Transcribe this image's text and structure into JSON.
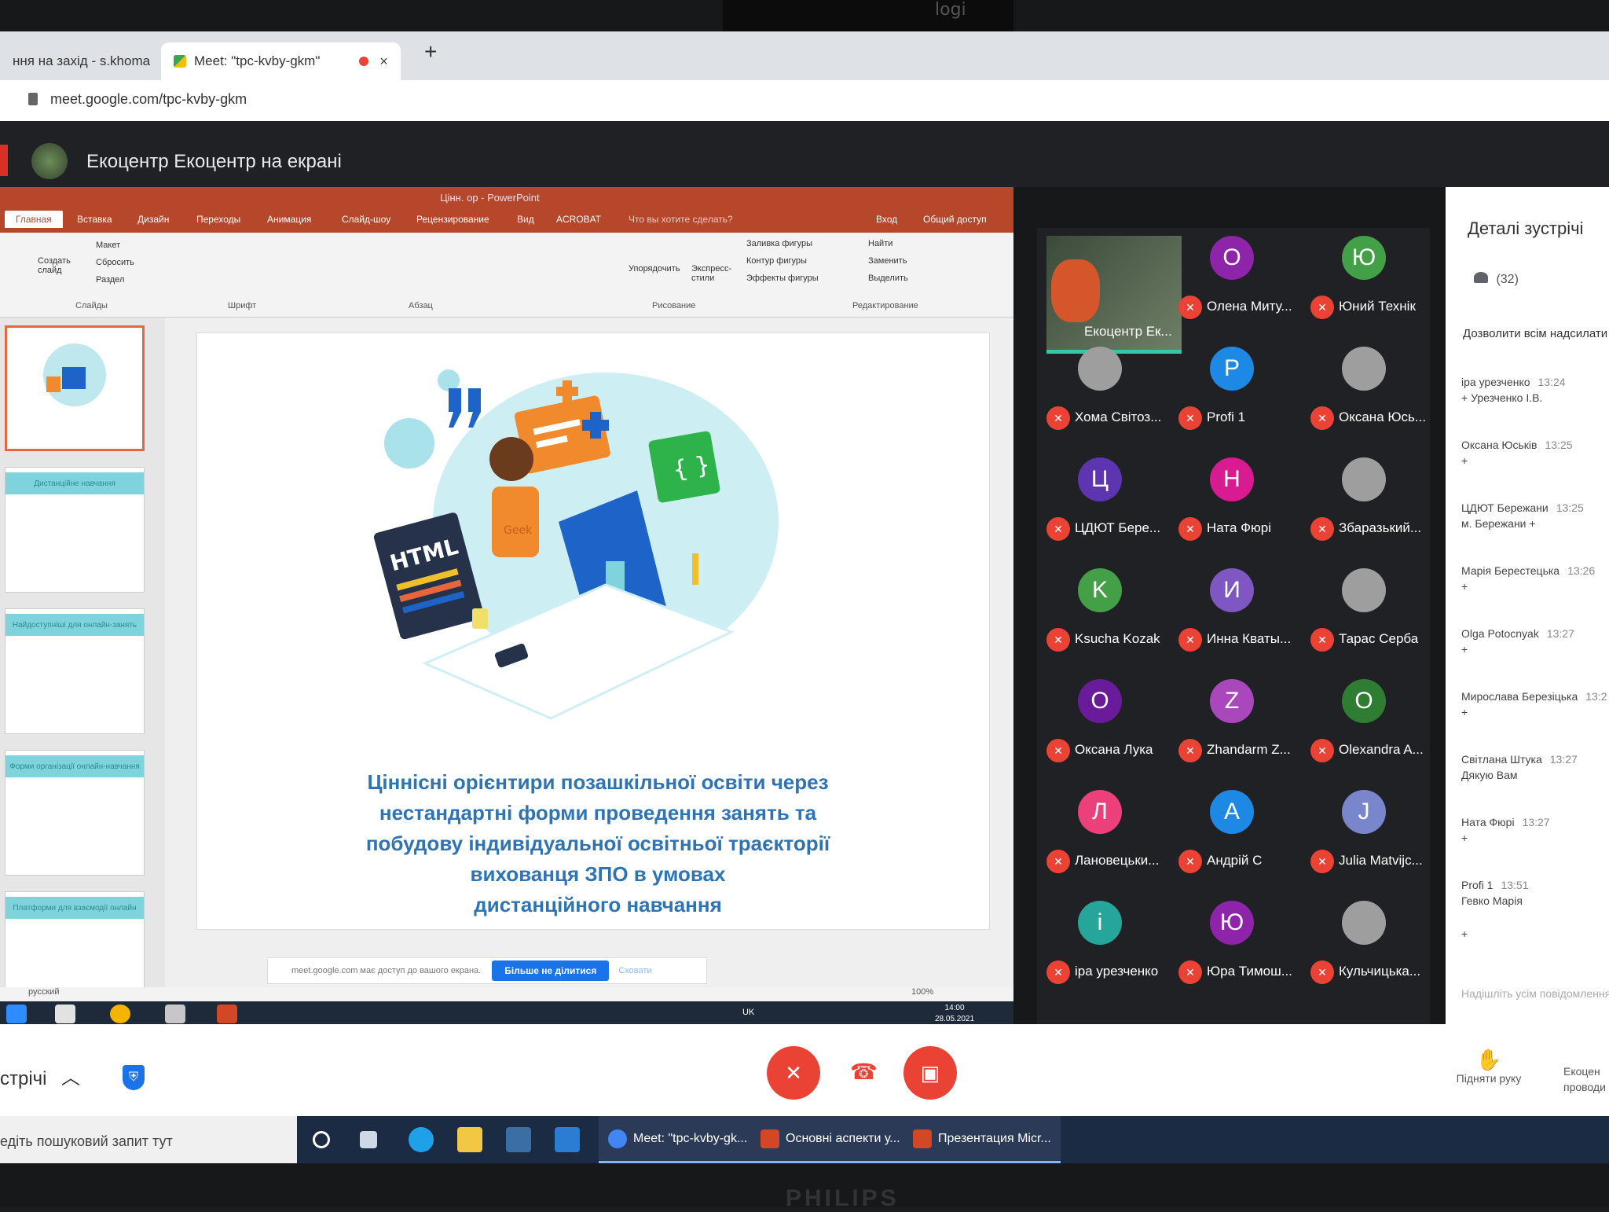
{
  "browser": {
    "tabs": [
      {
        "label": "ння на захід - s.khoma",
        "close": "×"
      },
      {
        "label": "Meet: \"tpc-kvby-gkm\"",
        "close": "×"
      }
    ],
    "new_tab": "+",
    "url": "meet.google.com/tpc-kvby-gkm"
  },
  "meet": {
    "presenter_title": "Екоцентр Екоцентр на екрані",
    "participants": [
      {
        "name": "Екоцентр Ек...",
        "initial": "",
        "color": "",
        "video": true
      },
      {
        "name": "Олена Миту...",
        "initial": "О",
        "color": "#8e24aa"
      },
      {
        "name": "Юний Технік",
        "initial": "Ю",
        "color": "#43a047"
      },
      {
        "name": "Хома Світоз...",
        "initial": "",
        "color": "#9e9e9e"
      },
      {
        "name": "Profi 1",
        "initial": "P",
        "color": "#1e88e5"
      },
      {
        "name": "Оксана Юсь...",
        "initial": "",
        "color": "#9e9e9e"
      },
      {
        "name": "ЦДЮТ Бере...",
        "initial": "Ц",
        "color": "#5e35b1"
      },
      {
        "name": "Ната Фюрі",
        "initial": "Н",
        "color": "#d81b90"
      },
      {
        "name": "Збаразький...",
        "initial": "",
        "color": "#9e9e9e"
      },
      {
        "name": "Ksucha Kozak",
        "initial": "K",
        "color": "#43a047"
      },
      {
        "name": "Инна Кваты...",
        "initial": "И",
        "color": "#7e57c2"
      },
      {
        "name": "Тарас Серба",
        "initial": "",
        "color": "#9e9e9e"
      },
      {
        "name": "Оксана Лука",
        "initial": "О",
        "color": "#6a1b9a"
      },
      {
        "name": "Zhandarm Z...",
        "initial": "Z",
        "color": "#ab47bc"
      },
      {
        "name": "Olexandra A...",
        "initial": "O",
        "color": "#2e7d32"
      },
      {
        "name": "Лановецьки...",
        "initial": "Л",
        "color": "#ec407a"
      },
      {
        "name": "Андрій С",
        "initial": "А",
        "color": "#1e88e5"
      },
      {
        "name": "Julia Matvijc...",
        "initial": "J",
        "color": "#7986cb"
      },
      {
        "name": "іра урезченко",
        "initial": "і",
        "color": "#26a69a"
      },
      {
        "name": "Юра Тимош...",
        "initial": "Ю",
        "color": "#8e24aa"
      },
      {
        "name": "Кульчицька...",
        "initial": "",
        "color": "#9e9e9e"
      }
    ],
    "panel": {
      "title": "Деталі зустрічі",
      "count": "(32)",
      "allow": "Дозволити всім надсилати",
      "messages": [
        {
          "name": "іра урезченко",
          "time": "13:24",
          "text": "+ Урезченко І.В."
        },
        {
          "name": "Оксана Юськів",
          "time": "13:25",
          "text": "+"
        },
        {
          "name": "ЦДЮТ Бережани",
          "time": "13:25",
          "text": "м. Бережани +"
        },
        {
          "name": "Марія Берестецька",
          "time": "13:26",
          "text": "+"
        },
        {
          "name": "Olga Potocnyak",
          "time": "13:27",
          "text": "+"
        },
        {
          "name": "Мирослава Березіцька",
          "time": "13:2",
          "text": "+"
        },
        {
          "name": "Світлана Штука",
          "time": "13:27",
          "text": "Дякую Вам"
        },
        {
          "name": "Ната Фюрі",
          "time": "13:27",
          "text": "+"
        },
        {
          "name": "Profi 1",
          "time": "13:51",
          "text": "Гевко Марія"
        }
      ],
      "extra_plus": "+",
      "send_placeholder": "Надішліть усім повідомлення"
    },
    "controls": {
      "meeting_label": "стрічі",
      "raise_hand": "Підняти руку",
      "presenter_note": "Екоцен проводи"
    }
  },
  "ppt": {
    "window_title": "Цінн. ор - PowerPoint",
    "tabs": [
      "Главная",
      "Вставка",
      "Дизайн",
      "Переходы",
      "Анимация",
      "Слайд-шоу",
      "Рецензирование",
      "Вид",
      "ACROBAT",
      "Что вы хотите сделать?"
    ],
    "login": "Вход",
    "share": "Общий доступ",
    "ribbon": {
      "create_slide": "Создать слайд",
      "layout": "Макет",
      "reset": "Сбросить",
      "section": "Раздел",
      "slides": "Слайды",
      "font": "Шрифт",
      "paragraph": "Абзац",
      "arrange": "Упорядочить",
      "express": "Экспресс-стили",
      "fill": "Заливка фигуры",
      "outline": "Контур фигуры",
      "effects": "Эффекты фигуры",
      "drawing": "Рисование",
      "find": "Найти",
      "replace": "Заменить",
      "select": "Выделить",
      "editing": "Редактирование"
    },
    "thumb_bands": [
      "Дистанційне навчання",
      "Найдоступніші для онлайн-занять",
      "Форми організації онлайн-навчання",
      "Платформи для взаємодії онлайн"
    ],
    "illus_html": "HTML",
    "illus_shirt": "Geek",
    "slide_title": [
      "Ціннісні орієнтири позашкільної  освіти через",
      "нестандартні форми проведення занять та",
      "побудову індивідуальної освітньої траєкторії",
      "вихованця ЗПО в умовах",
      "дистанційного навчання"
    ],
    "share_notice": "meet.google.com має доступ до вашого екрана.",
    "stop_sharing": "Більше не ділитися",
    "hide": "Сховати",
    "language": "русский",
    "zoom": "100%",
    "time": "14:00",
    "date": "28.05.2021",
    "lang_indicator": "UK"
  },
  "taskbar": {
    "search": "едіть пошуковий запит тут",
    "apps": [
      {
        "label": "Meet: \"tpc-kvby-gk...",
        "color": "#4285f4"
      },
      {
        "label": "Основні аспекти у...",
        "color": "#d24726"
      },
      {
        "label": "Презентация Micr...",
        "color": "#d24726"
      }
    ]
  },
  "monitor": {
    "brand": "PHILIPS",
    "webcam": "logi"
  }
}
